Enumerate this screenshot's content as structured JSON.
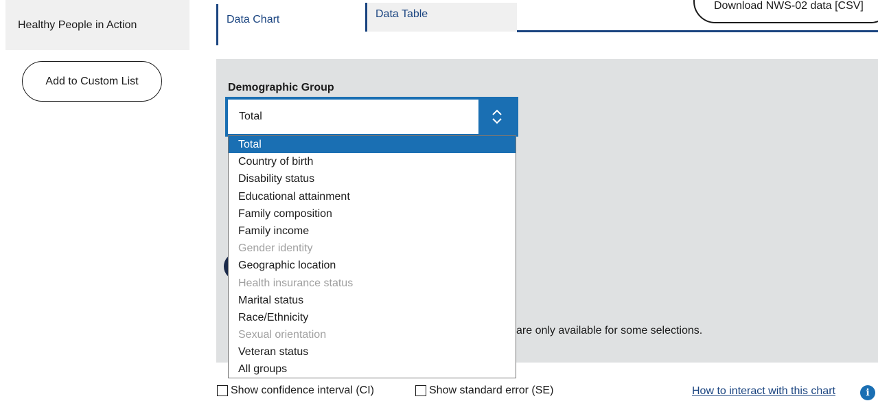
{
  "sidebar": {
    "section_title": "Healthy People in Action",
    "custom_list_button": "Add to Custom List"
  },
  "tabs": [
    {
      "label": "Data Chart"
    },
    {
      "label": "Data Table"
    }
  ],
  "download_button": "Download NWS-02 data [CSV]",
  "filters": {
    "demographic_label": "Demographic Group",
    "selected_value": "Total",
    "options": [
      {
        "label": "Total",
        "state": "selected"
      },
      {
        "label": "Country of birth",
        "state": "enabled"
      },
      {
        "label": "Disability status",
        "state": "enabled"
      },
      {
        "label": "Educational attainment",
        "state": "enabled"
      },
      {
        "label": "Family composition",
        "state": "enabled"
      },
      {
        "label": "Family income",
        "state": "enabled"
      },
      {
        "label": "Gender identity",
        "state": "disabled"
      },
      {
        "label": "Geographic location",
        "state": "enabled"
      },
      {
        "label": "Health insurance status",
        "state": "disabled"
      },
      {
        "label": "Marital status",
        "state": "enabled"
      },
      {
        "label": "Race/Ethnicity",
        "state": "enabled"
      },
      {
        "label": "Sexual orientation",
        "state": "disabled"
      },
      {
        "label": "Veteran status",
        "state": "enabled"
      },
      {
        "label": "All groups",
        "state": "enabled"
      }
    ],
    "note_fragment": "are only available for some selections."
  },
  "chart_options": {
    "ci_label": "Show confidence interval (CI)",
    "se_label": "Show standard error (SE)",
    "ci_checked": false,
    "se_checked": false,
    "help_link": "How to interact with this chart",
    "info_icon_glyph": "i"
  },
  "colors": {
    "accent": "#1a6fb3",
    "navy": "#1a4480",
    "panel": "#dfe1e2"
  }
}
